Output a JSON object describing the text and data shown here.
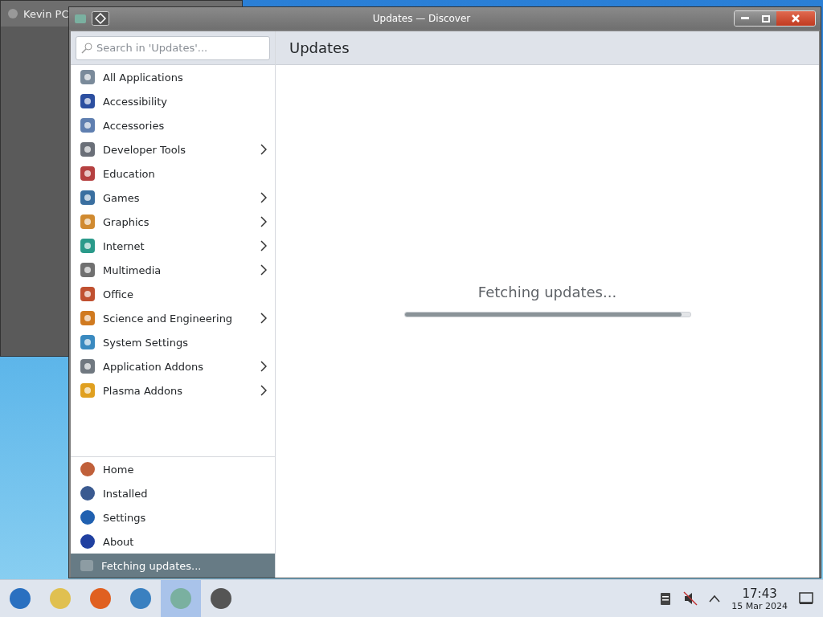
{
  "background_window": {
    "title": "Kevin PC"
  },
  "window": {
    "title": "Updates — Discover"
  },
  "search": {
    "placeholder": "Search in 'Updates'..."
  },
  "categories": [
    {
      "label": "All Applications",
      "expandable": false
    },
    {
      "label": "Accessibility",
      "expandable": false
    },
    {
      "label": "Accessories",
      "expandable": false
    },
    {
      "label": "Developer Tools",
      "expandable": true
    },
    {
      "label": "Education",
      "expandable": false
    },
    {
      "label": "Games",
      "expandable": true
    },
    {
      "label": "Graphics",
      "expandable": true
    },
    {
      "label": "Internet",
      "expandable": true
    },
    {
      "label": "Multimedia",
      "expandable": true
    },
    {
      "label": "Office",
      "expandable": false
    },
    {
      "label": "Science and Engineering",
      "expandable": true
    },
    {
      "label": "System Settings",
      "expandable": false
    },
    {
      "label": "Application Addons",
      "expandable": true
    },
    {
      "label": "Plasma Addons",
      "expandable": true
    }
  ],
  "navigation": [
    {
      "label": "Home",
      "selected": false
    },
    {
      "label": "Installed",
      "selected": false
    },
    {
      "label": "Settings",
      "selected": false
    },
    {
      "label": "About",
      "selected": false
    }
  ],
  "status_item": {
    "label": "Fetching updates..."
  },
  "page": {
    "title": "Updates",
    "message": "Fetching updates...",
    "progress": {
      "level": 0.97
    }
  },
  "taskbar": {
    "apps": [
      {
        "selected": false
      },
      {
        "selected": false
      },
      {
        "selected": false
      },
      {
        "selected": false
      },
      {
        "selected": true
      },
      {
        "selected": false
      }
    ],
    "time": "17:43",
    "date": "15 Mar 2024"
  }
}
